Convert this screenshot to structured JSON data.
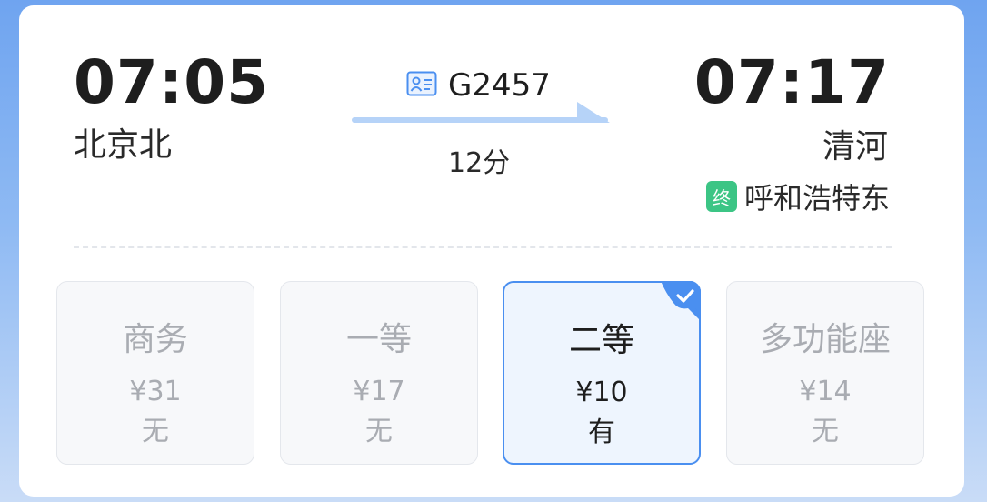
{
  "trip": {
    "departure": {
      "time": "07:05",
      "station": "北京北"
    },
    "arrival": {
      "time": "07:17",
      "station": "清河"
    },
    "train_number": "G2457",
    "duration": "12分",
    "terminal": {
      "badge": "终",
      "station": "呼和浩特东"
    }
  },
  "seats": [
    {
      "name": "商务",
      "price": "¥31",
      "availability": "无",
      "selected": false
    },
    {
      "name": "一等",
      "price": "¥17",
      "availability": "无",
      "selected": false
    },
    {
      "name": "二等",
      "price": "¥10",
      "availability": "有",
      "selected": true
    },
    {
      "name": "多功能座",
      "price": "¥14",
      "availability": "无",
      "selected": false
    }
  ],
  "colors": {
    "accent": "#4a8ff0",
    "terminal_badge": "#3cc585",
    "arrow": "#b6d3f8",
    "unavailable_text": "#a9acb2"
  },
  "icons": {
    "train": "id-card-icon",
    "selected": "checkmark-icon"
  }
}
